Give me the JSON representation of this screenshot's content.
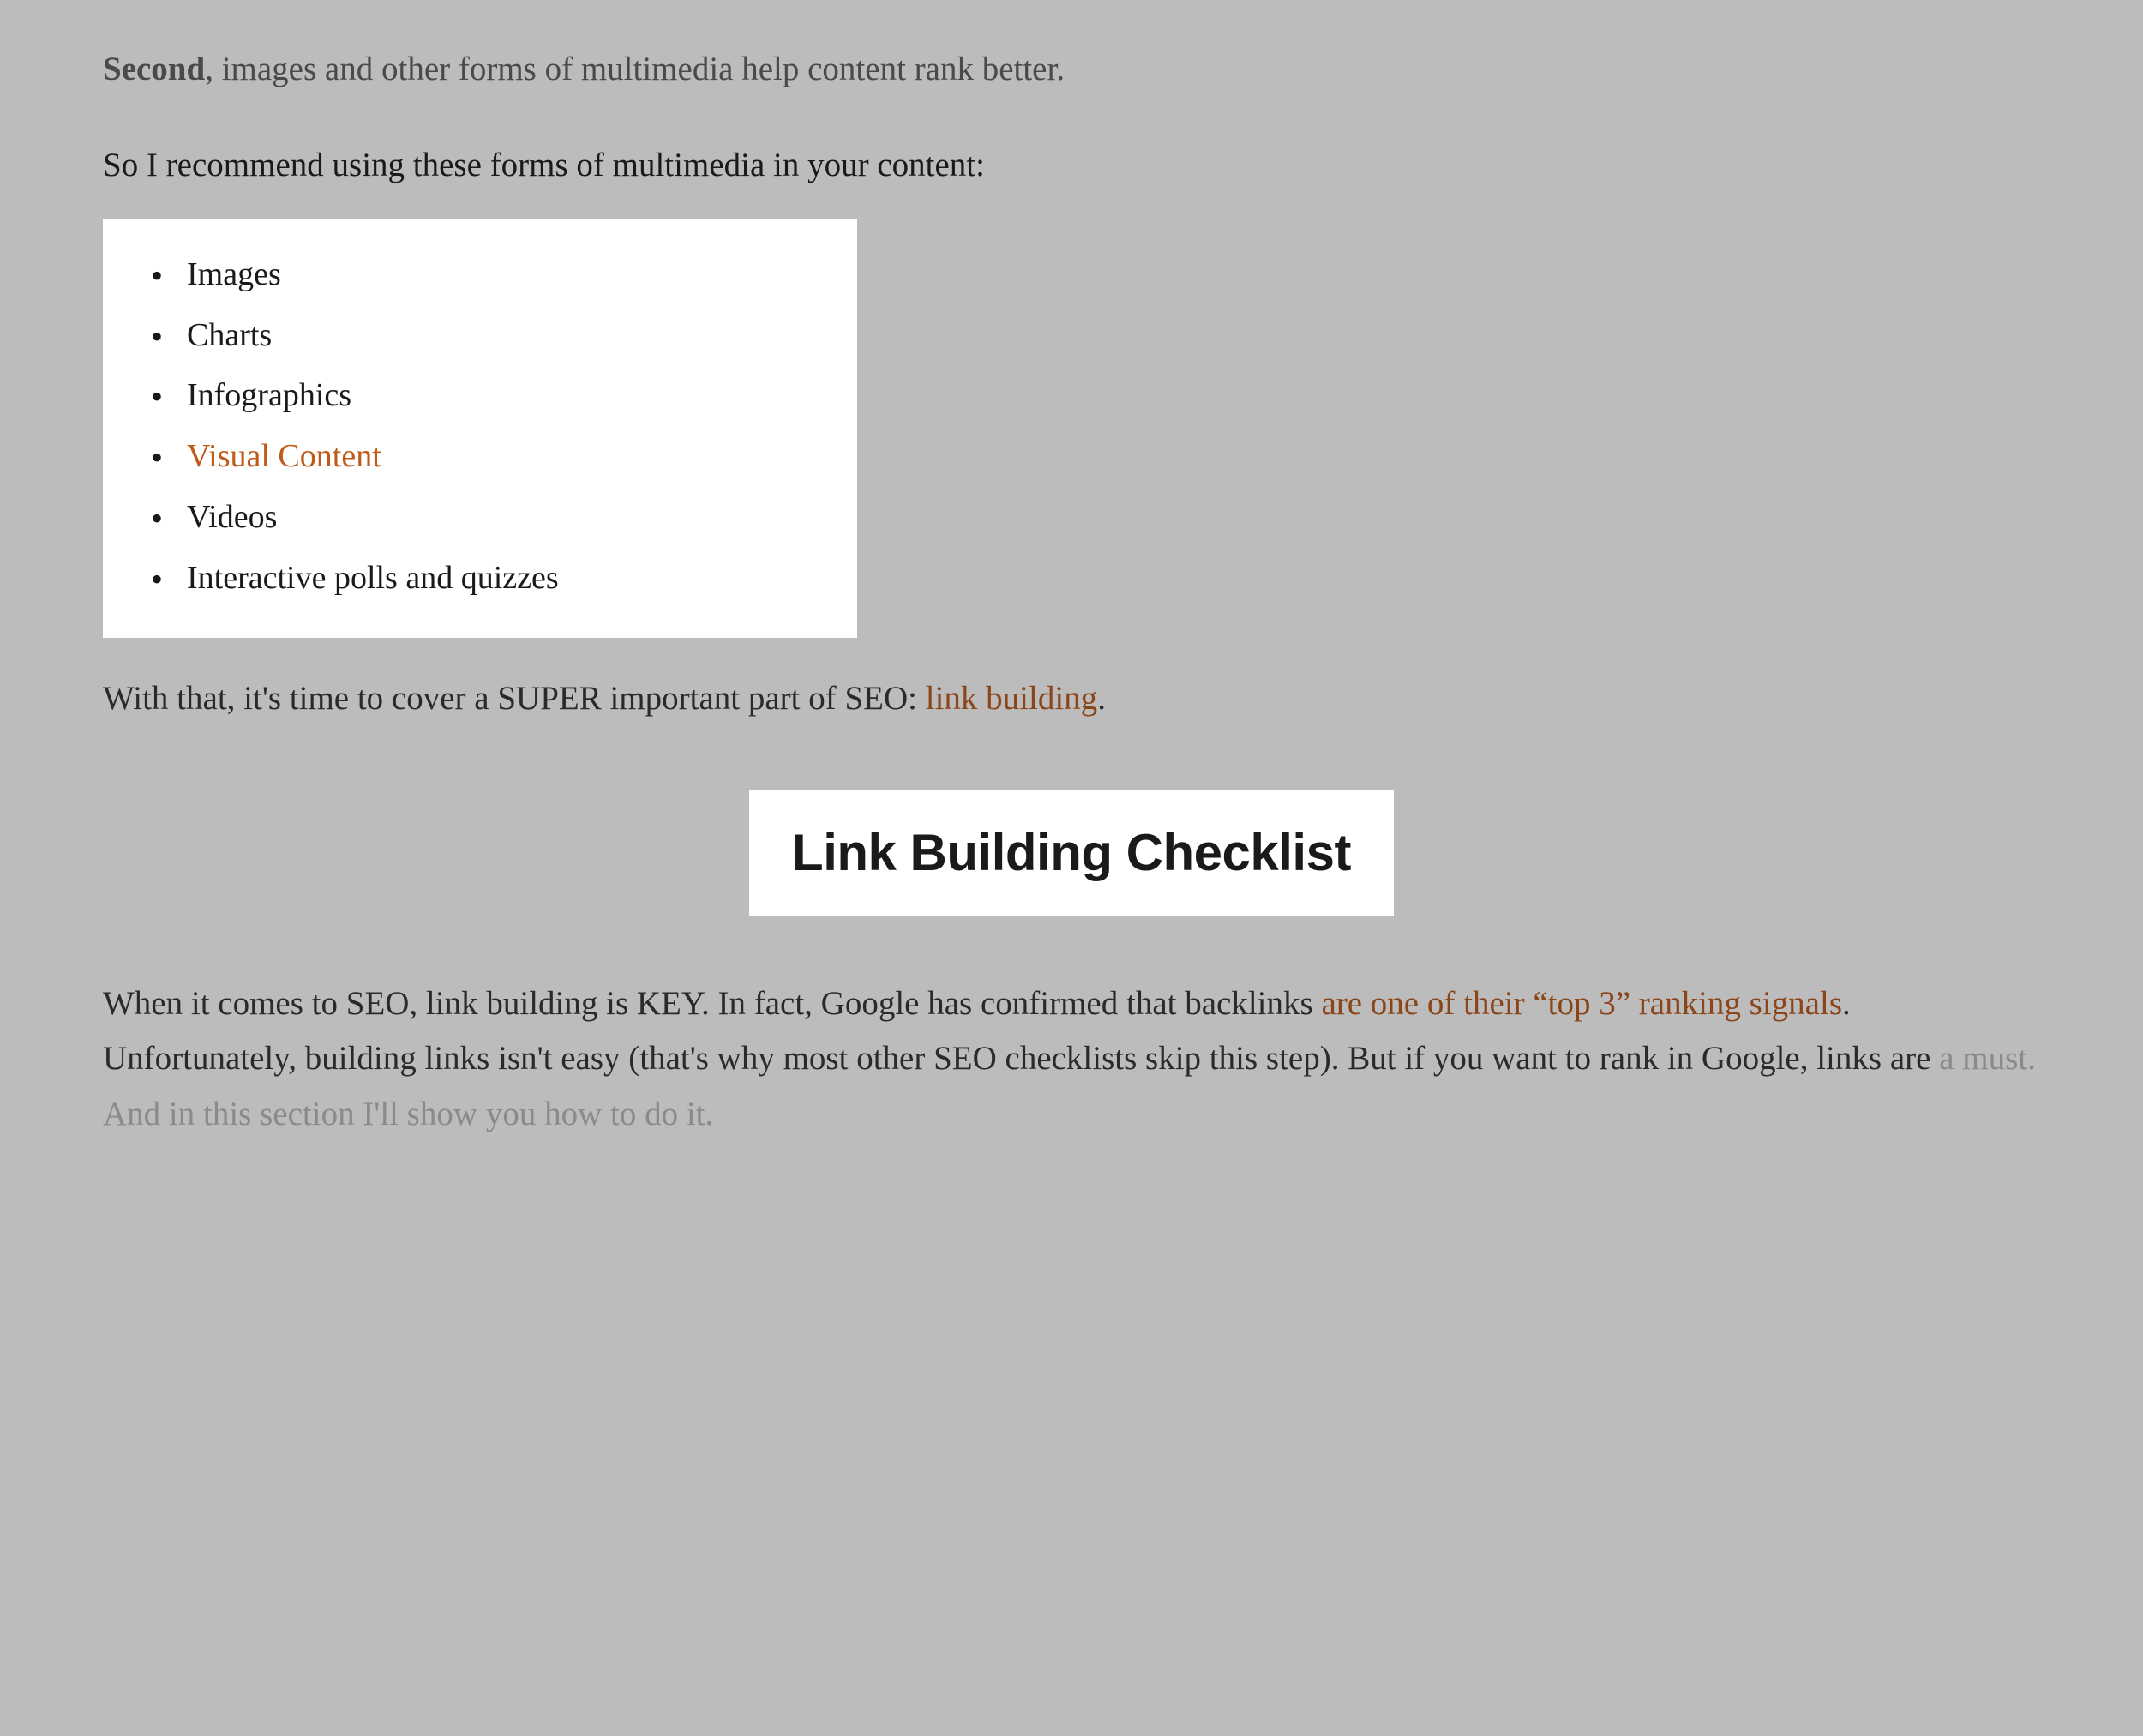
{
  "para1": {
    "bold": "Second",
    "rest": ", images and other forms of multimedia help content rank better."
  },
  "para2": "So I recommend using these forms of multimedia in your content:",
  "multimedia_list": {
    "items": [
      {
        "label": "Images",
        "is_link": false
      },
      {
        "label": "Charts",
        "is_link": false
      },
      {
        "label": "Infographics",
        "is_link": false
      },
      {
        "label": "Visual Content",
        "is_link": true
      },
      {
        "label": "Videos",
        "is_link": false
      },
      {
        "label": "Interactive polls and quizzes",
        "is_link": false
      }
    ]
  },
  "para3": {
    "before_link": "With that, it's time to cover a SUPER important part of SEO: ",
    "link": "link building",
    "after_link": "."
  },
  "heading": "Link Building Checklist",
  "para4": {
    "part1": "When it comes to SEO, link building is KEY. In fact, Google has confirmed that backlinks ",
    "link": "are one of their “top 3” ranking signals",
    "part2": ". Unfortunately, building links isn't easy (that's why most other SEO checklists skip this step). But if you want to rank in Google, links are ",
    "faded": "a must. And in this section I'll show you how to do it."
  }
}
